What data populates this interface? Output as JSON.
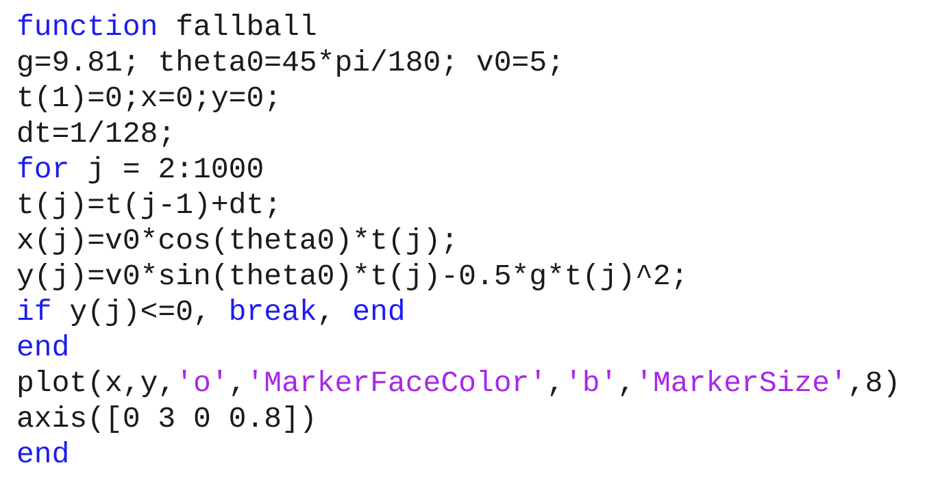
{
  "colors": {
    "keyword": "#1c1cf0",
    "string": "#a828e8",
    "text": "#1a1a1a",
    "background": "#ffffff"
  },
  "code": {
    "language": "MATLAB",
    "lines": [
      [
        {
          "t": "kw",
          "s": "function"
        },
        {
          "t": "plain",
          "s": " fallball"
        }
      ],
      [
        {
          "t": "plain",
          "s": "g=9.81; theta0=45*pi/180; v0=5;"
        }
      ],
      [
        {
          "t": "plain",
          "s": "t(1)=0;x=0;y=0;"
        }
      ],
      [
        {
          "t": "plain",
          "s": "dt=1/128;"
        }
      ],
      [
        {
          "t": "kw",
          "s": "for"
        },
        {
          "t": "plain",
          "s": " j = 2:1000"
        }
      ],
      [
        {
          "t": "plain",
          "s": "t(j)=t(j-1)+dt;"
        }
      ],
      [
        {
          "t": "plain",
          "s": "x(j)=v0*cos(theta0)*t(j);"
        }
      ],
      [
        {
          "t": "plain",
          "s": "y(j)=v0*sin(theta0)*t(j)-0.5*g*t(j)^2;"
        }
      ],
      [
        {
          "t": "kw",
          "s": "if"
        },
        {
          "t": "plain",
          "s": " y(j)<=0, "
        },
        {
          "t": "kw",
          "s": "break"
        },
        {
          "t": "plain",
          "s": ", "
        },
        {
          "t": "kw",
          "s": "end"
        }
      ],
      [
        {
          "t": "kw",
          "s": "end"
        }
      ],
      [
        {
          "t": "plain",
          "s": "plot(x,y,"
        },
        {
          "t": "str",
          "s": "'o'"
        },
        {
          "t": "plain",
          "s": ","
        },
        {
          "t": "str",
          "s": "'MarkerFaceColor'"
        },
        {
          "t": "plain",
          "s": ","
        },
        {
          "t": "str",
          "s": "'b'"
        },
        {
          "t": "plain",
          "s": ","
        },
        {
          "t": "str",
          "s": "'MarkerSize'"
        },
        {
          "t": "plain",
          "s": ",8)"
        }
      ],
      [
        {
          "t": "plain",
          "s": "axis([0 3 0 0.8])"
        }
      ],
      [
        {
          "t": "kw",
          "s": "end"
        }
      ]
    ]
  }
}
